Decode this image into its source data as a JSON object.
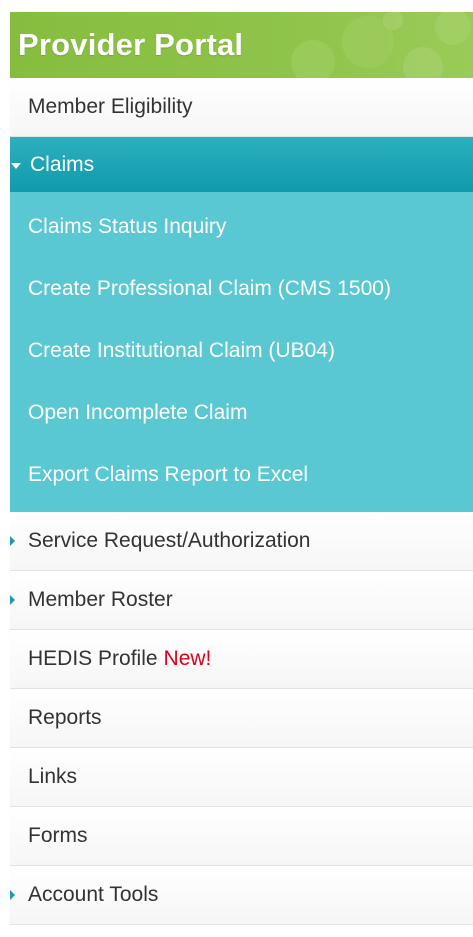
{
  "header": {
    "title": "Provider Portal"
  },
  "menu": {
    "member_eligibility": "Member Eligibility",
    "claims": {
      "label": "Claims",
      "items": [
        "Claims Status Inquiry",
        "Create Professional Claim (CMS 1500)",
        "Create Institutional Claim (UB04)",
        "Open Incomplete Claim",
        "Export Claims Report to Excel"
      ]
    },
    "service_request": "Service Request/Authorization",
    "member_roster": "Member Roster",
    "hedis_profile": "HEDIS Profile",
    "hedis_new": "New!",
    "reports": "Reports",
    "links": "Links",
    "forms": "Forms",
    "account_tools": "Account Tools"
  },
  "colors": {
    "header_green": "#8fc34a",
    "claims_teal": "#119aaa",
    "submenu_teal": "#5ac8d3",
    "new_red": "#e0001b",
    "arrow_teal": "#1a9bb1"
  }
}
